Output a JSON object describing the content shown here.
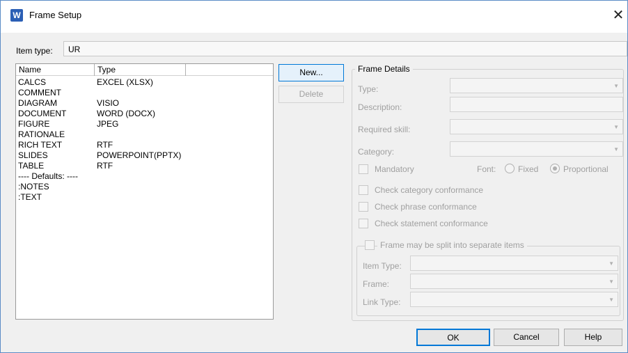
{
  "window": {
    "app_icon": "W",
    "title": "Frame Setup",
    "close_glyph": "✕"
  },
  "item_type": {
    "label": "Item type:",
    "value": "UR"
  },
  "list": {
    "columns": [
      "Name",
      "Type"
    ],
    "rows": [
      {
        "name": "CALCS",
        "type": "EXCEL (XLSX)"
      },
      {
        "name": "COMMENT",
        "type": ""
      },
      {
        "name": "DIAGRAM",
        "type": "VISIO"
      },
      {
        "name": "DOCUMENT",
        "type": "WORD (DOCX)"
      },
      {
        "name": "FIGURE",
        "type": "JPEG"
      },
      {
        "name": "RATIONALE",
        "type": ""
      },
      {
        "name": "RICH TEXT",
        "type": "RTF"
      },
      {
        "name": "SLIDES",
        "type": "POWERPOINT(PPTX)"
      },
      {
        "name": "TABLE",
        "type": "RTF"
      },
      {
        "name": "---- Defaults: ----",
        "type": ""
      },
      {
        "name": ":NOTES",
        "type": ""
      },
      {
        "name": ":TEXT",
        "type": ""
      }
    ]
  },
  "buttons": {
    "new": "New...",
    "delete": "Delete",
    "ok": "OK",
    "cancel": "Cancel",
    "help": "Help"
  },
  "frame_details": {
    "legend": "Frame Details",
    "type_label": "Type:",
    "description_label": "Description:",
    "required_skill_label": "Required skill:",
    "category_label": "Category:",
    "mandatory_label": "Mandatory",
    "font_label": "Font:",
    "font_fixed": "Fixed",
    "font_proportional": "Proportional",
    "font_selected": "Proportional",
    "check_category": "Check category conformance",
    "check_phrase": "Check phrase conformance",
    "check_statement": "Check statement conformance"
  },
  "split": {
    "legend": "Frame may be split into separate items",
    "item_type_label": "Item Type:",
    "frame_label": "Frame:",
    "link_type_label": "Link Type:"
  },
  "icons": {
    "dropdown": "chevron-down-icon",
    "close": "close-icon"
  }
}
